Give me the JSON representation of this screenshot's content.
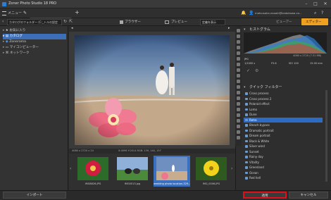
{
  "titlebar": {
    "title": "Zoner Photo Studio 18 PRO"
  },
  "menubar": {
    "menu_label": "メニュー",
    "tab_title": "wedding photo locatio...",
    "account": "matsusaka.naoaki@kadokawa.co..."
  },
  "toolbar": {
    "path": "カタログのフォルダー (C:_トルの設定",
    "browser": "ブラウザー",
    "preview": "プレビュー",
    "sort": "定義を表示",
    "viewer_mode": "ビューアー",
    "editor_mode": "エディター"
  },
  "leftpanel": {
    "items": [
      {
        "label": "お気に入り"
      },
      {
        "label": "カタログ"
      },
      {
        "label": "Zonerama"
      },
      {
        "label": "マイコンピューター"
      },
      {
        "label": "ネットワーク"
      }
    ],
    "import_button": "インポート"
  },
  "infobar": {
    "left": "4080 x 2720 x 24",
    "mid": "X:4096 Y:2014  RGB: 139, 140, 157"
  },
  "filmstrip": {
    "thumbs": [
      {
        "label": "IMG8826.JPG"
      },
      {
        "label": "IMG0013.jpg"
      },
      {
        "label": "wedding photo location-329..."
      },
      {
        "label": "IMG_0006.JPG"
      }
    ]
  },
  "histogram": {
    "title": "ヒストグラム",
    "dims": "4080 x 2720 (7.31 MB)",
    "format": "JPG",
    "shutter": "1/1000 s",
    "aperture": "F5.6",
    "iso": "ISO 100",
    "focal": "15.00 mm"
  },
  "quickfilter": {
    "title": "クイック フィルター",
    "items": [
      {
        "label": "Cross process"
      },
      {
        "label": "Cross process 2"
      },
      {
        "label": "Polaroid effect"
      },
      {
        "label": "Lomo"
      },
      {
        "label": "Dune"
      },
      {
        "label": "Retro"
      },
      {
        "label": "Bleach bypass"
      },
      {
        "label": "Dramatic portrait"
      },
      {
        "label": "Dream portrait"
      },
      {
        "label": "Black & White"
      },
      {
        "label": "Silver wind"
      },
      {
        "label": "Sunset"
      },
      {
        "label": "Rainy day"
      },
      {
        "label": "Vitality"
      },
      {
        "label": "Greenland"
      },
      {
        "label": "Ocean"
      },
      {
        "label": "Red hell"
      }
    ]
  },
  "buttons": {
    "apply": "適用",
    "cancel": "キャンセル"
  },
  "colors": {
    "accent": "#2e6bc4",
    "highlight": "#e0101a",
    "editor_tab": "#f0a020"
  }
}
